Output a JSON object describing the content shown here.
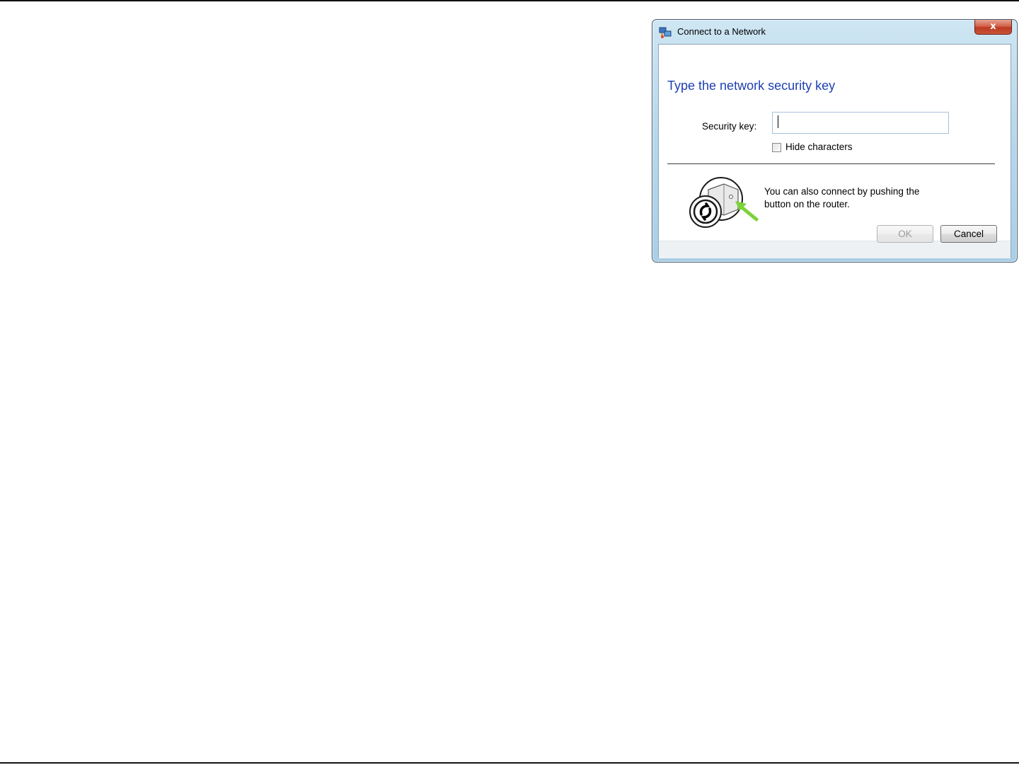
{
  "dialog": {
    "title": "Connect to a Network",
    "close_symbol": "x",
    "heading": "Type the network security key",
    "security_key_label": "Security key:",
    "security_key_value": "",
    "hide_characters_label": "Hide characters",
    "hide_characters_checked": false,
    "wps_text": "You can also connect by pushing the button on the router.",
    "ok_label": "OK",
    "ok_enabled": false,
    "cancel_label": "Cancel"
  },
  "icons": {
    "title": "network-icon",
    "wps": "router-push-button-icon"
  },
  "colors": {
    "heading": "#1e3fb4",
    "wps_arrow": "#7cd23a",
    "close_button": "#c8553a"
  }
}
